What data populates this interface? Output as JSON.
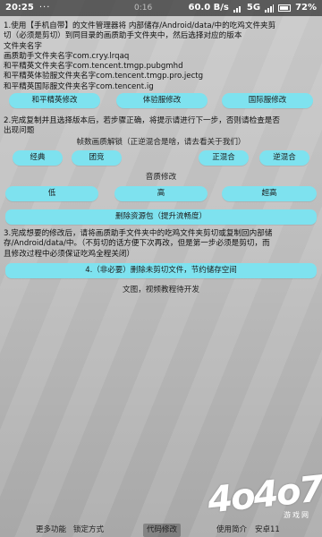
{
  "status_bar": {
    "time": "20:25",
    "dots": "···",
    "speed": "60.0 B/s",
    "network": "5G",
    "battery": "72%",
    "center_text": "0:16"
  },
  "info_block": {
    "line1_prefix": "1.使用【手机自带】的文件管理器将 内部储存/Android/data/中的吃鸡文件夹剪",
    "line2": "切（必须是剪切）到同目录的画质助手文件夹中，然后选择对应的版本",
    "line3": "文件夹名字",
    "line4": "画质助手文件夹名字com.cryy.lrqaq",
    "line5": "和平精英文件夹名字com.tencent.tmgp.pubgmhd",
    "line6": "和平精英体验服文件夹名字com.tencent.tmgp.pro.jectg",
    "line7": "和平精英国际服文件夹名字com.tencent.ig"
  },
  "version_buttons": {
    "normal": "和平精英修改",
    "beta": "体验服修改",
    "intl": "国际服修改"
  },
  "step2": {
    "line1": "2.完成复制并且选择版本后，若步骤正确，将提示请进行下一步，否则请检查是否",
    "line2": "出现问题"
  },
  "unlock_title": "帧数画质解锁（正逆混合是啥，请去看关于我们）",
  "mode_buttons": {
    "classic": "经典",
    "team": "团竞",
    "forward_mix": "正混合",
    "reverse_mix": "逆混合"
  },
  "quality_title": "音质修改",
  "quality_buttons": {
    "low": "低",
    "high": "高",
    "ultra": "超高"
  },
  "delete_pack_button": "删除资源包（提升流畅度）",
  "step3": {
    "line1": "3.完成想要的修改后，请将画质助手文件夹中的吃鸡文件夹剪切或复制回内部储",
    "line2": "存/Android/data/中。（不剪切的话方便下次再改，但是第一步必须是剪切，而",
    "line3": "且修改过程中必须保证吃鸡全程关闭）"
  },
  "delete_unused_button": "4.（非必要）删除未剪切文件，节约储存空间",
  "tutorial_text": "文图，视频教程待开发",
  "bottom_nav": {
    "more": "更多功能",
    "lock": "锁定方式",
    "code": "代码修改",
    "intro": "使用简介",
    "android": "安卓11"
  },
  "watermark": {
    "logo_text": "4o4o7",
    "sub_text": "游戏网"
  },
  "colors": {
    "button": "#7ee2ef",
    "highlight_text": "#1f4aa8"
  }
}
